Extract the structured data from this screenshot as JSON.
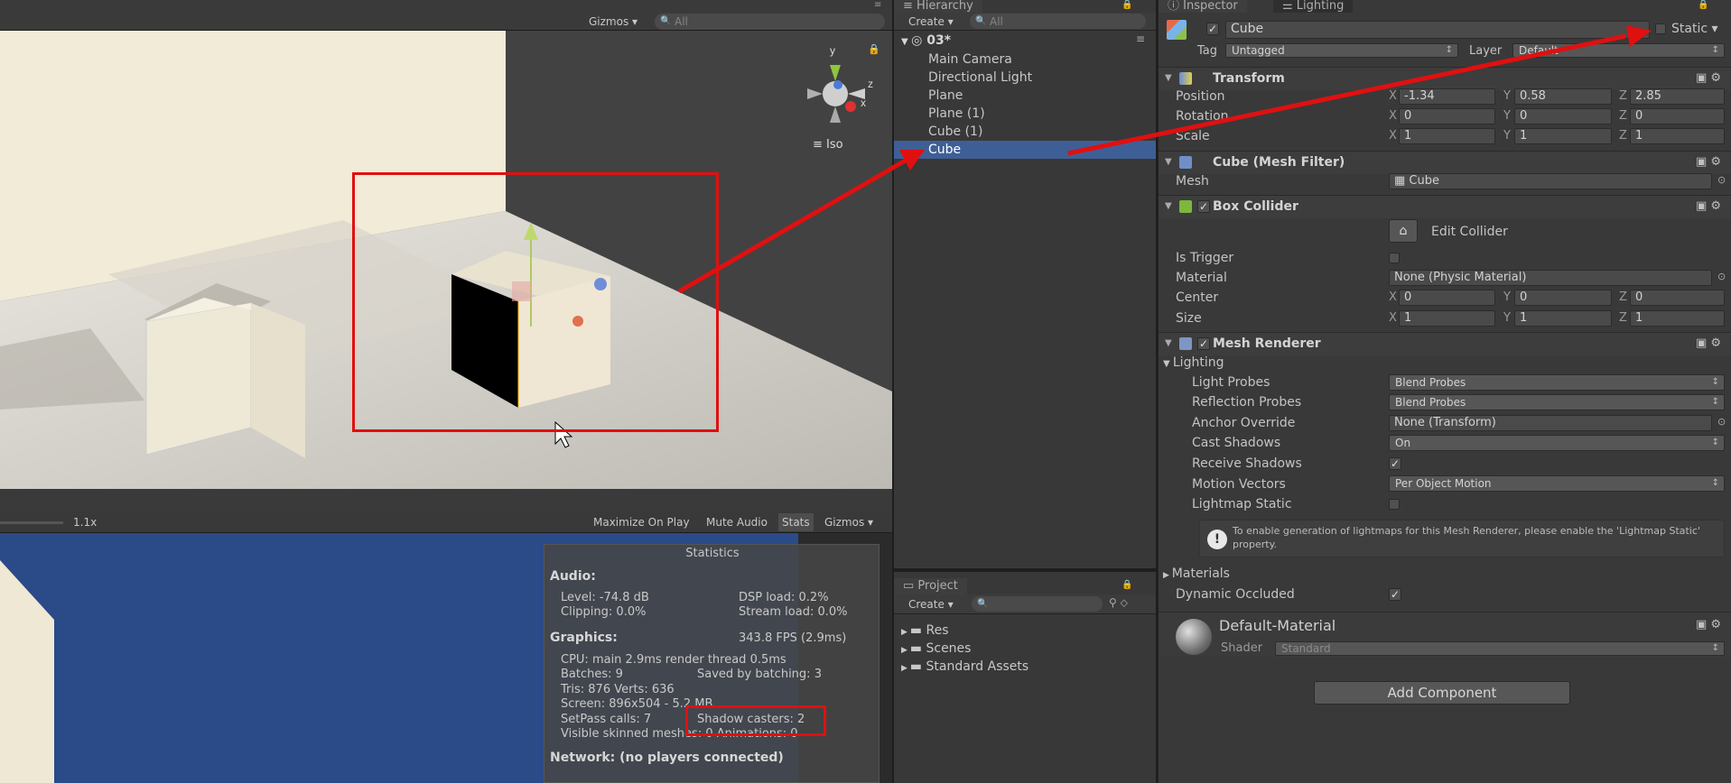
{
  "scene_toolbar": {
    "gizmos": "Gizmos",
    "search_placeholder": "All",
    "iso": "Iso"
  },
  "game_toolbar": {
    "scale": "1.1x",
    "maximize": "Maximize On Play",
    "mute": "Mute Audio",
    "stats": "Stats",
    "gizmos": "Gizmos"
  },
  "hierarchy": {
    "tab": "Hierarchy",
    "create": "Create",
    "search_placeholder": "All",
    "scene_name": "03*",
    "items": [
      "Main Camera",
      "Directional Light",
      "Plane",
      "Plane (1)",
      "Cube (1)",
      "Cube"
    ]
  },
  "project": {
    "tab": "Project",
    "create": "Create",
    "folders": [
      "Res",
      "Scenes",
      "Standard Assets"
    ]
  },
  "inspector": {
    "tabs": [
      "Inspector",
      "Lighting"
    ],
    "object_name": "Cube",
    "static_label": "Static",
    "tag_label": "Tag",
    "tag_value": "Untagged",
    "layer_label": "Layer",
    "layer_value": "Default",
    "transform": {
      "title": "Transform",
      "position_label": "Position",
      "pos_x": "-1.34",
      "pos_y": "0.58",
      "pos_z": "2.85",
      "rotation_label": "Rotation",
      "rot_x": "0",
      "rot_y": "0",
      "rot_z": "0",
      "scale_label": "Scale",
      "scl_x": "1",
      "scl_y": "1",
      "scl_z": "1"
    },
    "mesh_filter": {
      "title": "Cube (Mesh Filter)",
      "mesh_label": "Mesh",
      "mesh_value": "Cube"
    },
    "box_collider": {
      "title": "Box Collider",
      "edit_collider": "Edit Collider",
      "is_trigger": "Is Trigger",
      "material_label": "Material",
      "material_value": "None (Physic Material)",
      "center_label": "Center",
      "cx": "0",
      "cy": "0",
      "cz": "0",
      "size_label": "Size",
      "sx": "1",
      "sy": "1",
      "sz": "1"
    },
    "mesh_renderer": {
      "title": "Mesh Renderer",
      "lighting": "Lighting",
      "light_probes_label": "Light Probes",
      "light_probes_value": "Blend Probes",
      "reflection_probes_label": "Reflection Probes",
      "reflection_probes_value": "Blend Probes",
      "anchor_label": "Anchor Override",
      "anchor_value": "None (Transform)",
      "cast_label": "Cast Shadows",
      "cast_value": "On",
      "receive_label": "Receive Shadows",
      "motion_label": "Motion Vectors",
      "motion_value": "Per Object Motion",
      "lightmap_label": "Lightmap Static",
      "info": "To enable generation of lightmaps for this Mesh Renderer, please enable the 'Lightmap Static' property.",
      "materials": "Materials",
      "dynamic_label": "Dynamic Occluded"
    },
    "material": {
      "name": "Default-Material",
      "shader_label": "Shader",
      "shader_value": "Standard"
    },
    "add_component": "Add Component"
  },
  "statistics": {
    "title": "Statistics",
    "audio_h": "Audio:",
    "level": "Level: -74.8 dB",
    "clipping": "Clipping: 0.0%",
    "dsp": "DSP load: 0.2%",
    "stream": "Stream load: 0.0%",
    "graphics_h": "Graphics:",
    "fps": "343.8 FPS (2.9ms)",
    "cpu": "CPU: main 2.9ms  render thread 0.5ms",
    "batches": "Batches: 9",
    "saved": "Saved by batching: 3",
    "tris": "Tris: 876  Verts: 636",
    "screen": "Screen: 896x504 - 5.2 MB",
    "setpass": "SetPass calls: 7",
    "shadow": "Shadow casters: 2",
    "skinned": "Visible skinned meshes: 0  Animations: 0",
    "network": "Network: (no players connected)"
  },
  "colors": {
    "annotation": "#e01010",
    "selected_row": "#3e5f96",
    "game_background": "#2b4a88"
  },
  "icons": [
    "search-icon",
    "gear-icon",
    "lock-icon",
    "menu-icon",
    "scene-icon",
    "folder-icon",
    "cube-icon",
    "info-icon",
    "checkmark-icon"
  ]
}
